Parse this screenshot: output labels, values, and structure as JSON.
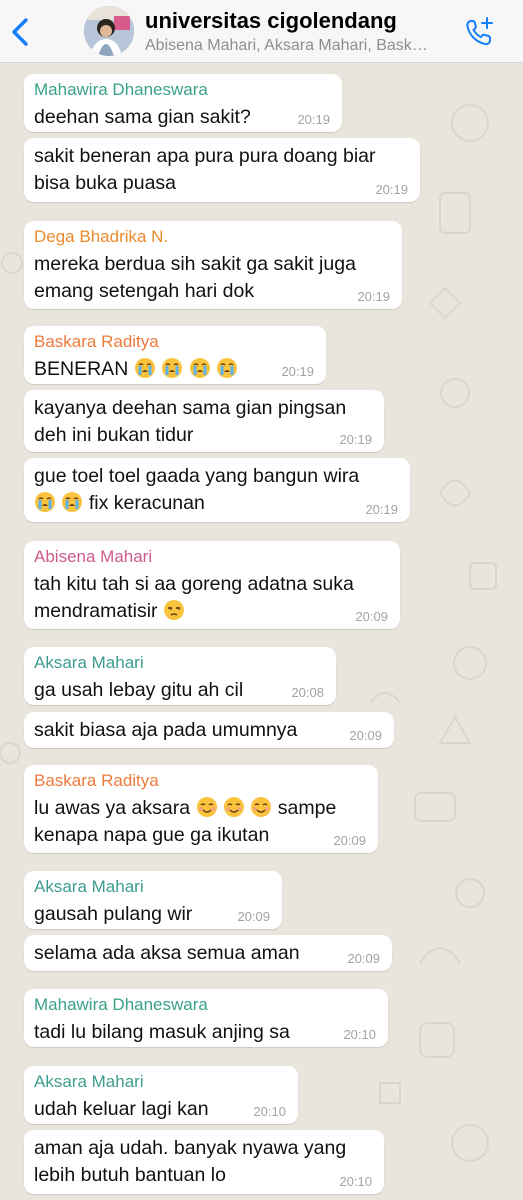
{
  "header": {
    "back_icon": "chevron-left-icon",
    "title": "universitas cigolendang",
    "subtitle": "Abisena Mahari, Aksara Mahari, Baskara Raditya, Dega Bhadrika N., Mahawira Dhaneswara",
    "call_icon": "add-call-icon",
    "accent": "#157efb"
  },
  "colors": {
    "mahawira": "#3aa18a",
    "dega": "#ec8a2c",
    "baskara": "#ef7a3c",
    "abisena": "#cf5b8c",
    "aksara": "#3f9d8f",
    "bubble": "#ffffff",
    "wallpaper": "#e9e4dc"
  },
  "messages": [
    {
      "sender": "Mahawira Dhaneswara",
      "text": "deehan sama gian sakit?",
      "time": "20:19"
    },
    {
      "text": "sakit beneran apa pura pura doang biar bisa buka puasa",
      "time": "20:19"
    },
    {
      "sender": "Dega Bhadrika N.",
      "text": "mereka berdua sih sakit ga sakit juga emang setengah hari dok",
      "time": "20:19"
    },
    {
      "sender": "Baskara Raditya",
      "text": "BENERAN",
      "emojis": [
        "loudly-crying-face",
        "loudly-crying-face",
        "loudly-crying-face",
        "loudly-crying-face"
      ],
      "time": "20:19"
    },
    {
      "text": "kayanya deehan sama gian pingsan deh ini bukan tidur",
      "time": "20:19"
    },
    {
      "text_line1": "gue toel toel gaada yang bangun wira",
      "emojis": [
        "loudly-crying-face",
        "loudly-crying-face"
      ],
      "text_line2": "fix keracunan",
      "time": "20:19"
    },
    {
      "sender": "Abisena Mahari",
      "text_line1": "tah kitu tah si aa goreng adatna suka",
      "text_line2": "mendramatisir",
      "emojis": [
        "unamused-face"
      ],
      "time": "20:09"
    },
    {
      "sender": "Aksara Mahari",
      "text": "ga usah lebay gitu ah cil",
      "time": "20:08"
    },
    {
      "text": "sakit biasa aja pada umumnya",
      "time": "20:09"
    },
    {
      "sender": "Baskara Raditya",
      "text_line1": "lu awas ya aksara",
      "emojis": [
        "smiling-face-with-smiling-eyes",
        "smiling-face-with-smiling-eyes",
        "smiling-face-with-smiling-eyes"
      ],
      "text_line1_end": "sampe",
      "text_line2": "kenapa napa gue ga ikutan",
      "time": "20:09"
    },
    {
      "sender": "Aksara Mahari",
      "text": "gausah pulang wir",
      "time": "20:09"
    },
    {
      "text": "selama ada aksa semua aman",
      "time": "20:09"
    },
    {
      "sender": "Mahawira Dhaneswara",
      "text": "tadi lu bilang masuk anjing sa",
      "time": "20:10"
    },
    {
      "sender": "Aksara Mahari",
      "text": "udah keluar lagi kan",
      "time": "20:10"
    },
    {
      "text": "aman aja udah. banyak nyawa yang lebih butuh bantuan lo",
      "time": "20:10"
    }
  ]
}
